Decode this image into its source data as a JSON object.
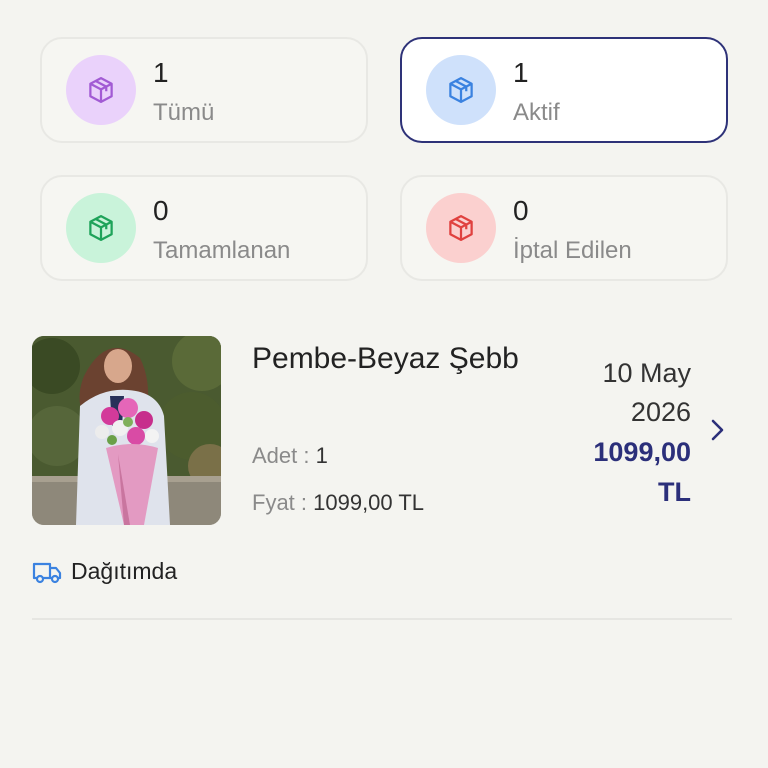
{
  "stats": [
    {
      "count": "1",
      "label": "Tümü",
      "icon": "box-icon",
      "color": "#a25bd4",
      "bg": "#ead2fb",
      "active": false
    },
    {
      "count": "1",
      "label": "Aktif",
      "icon": "box-icon",
      "color": "#3b82e0",
      "bg": "#cfe1fb",
      "active": true
    },
    {
      "count": "0",
      "label": "Tamamlanan",
      "icon": "box-icon",
      "color": "#1fa35a",
      "bg": "#c9f3da",
      "active": false
    },
    {
      "count": "0",
      "label": "İptal Edilen",
      "icon": "box-icon",
      "color": "#e0413f",
      "bg": "#fbd0cf",
      "active": false
    }
  ],
  "order": {
    "title": "Pembe-Beyaz Şebb",
    "date_line1": "10 May",
    "date_line2": "2026",
    "price_line1": "1099,00",
    "price_line2": "TL",
    "qty_label": "Adet : ",
    "qty_value": "1",
    "price_label": "Fyat : ",
    "price_value": "1099,00 TL",
    "status": "Dağıtımda",
    "status_icon": "truck-icon",
    "status_color": "#3b82e0",
    "price_color": "#2b2f7a"
  }
}
